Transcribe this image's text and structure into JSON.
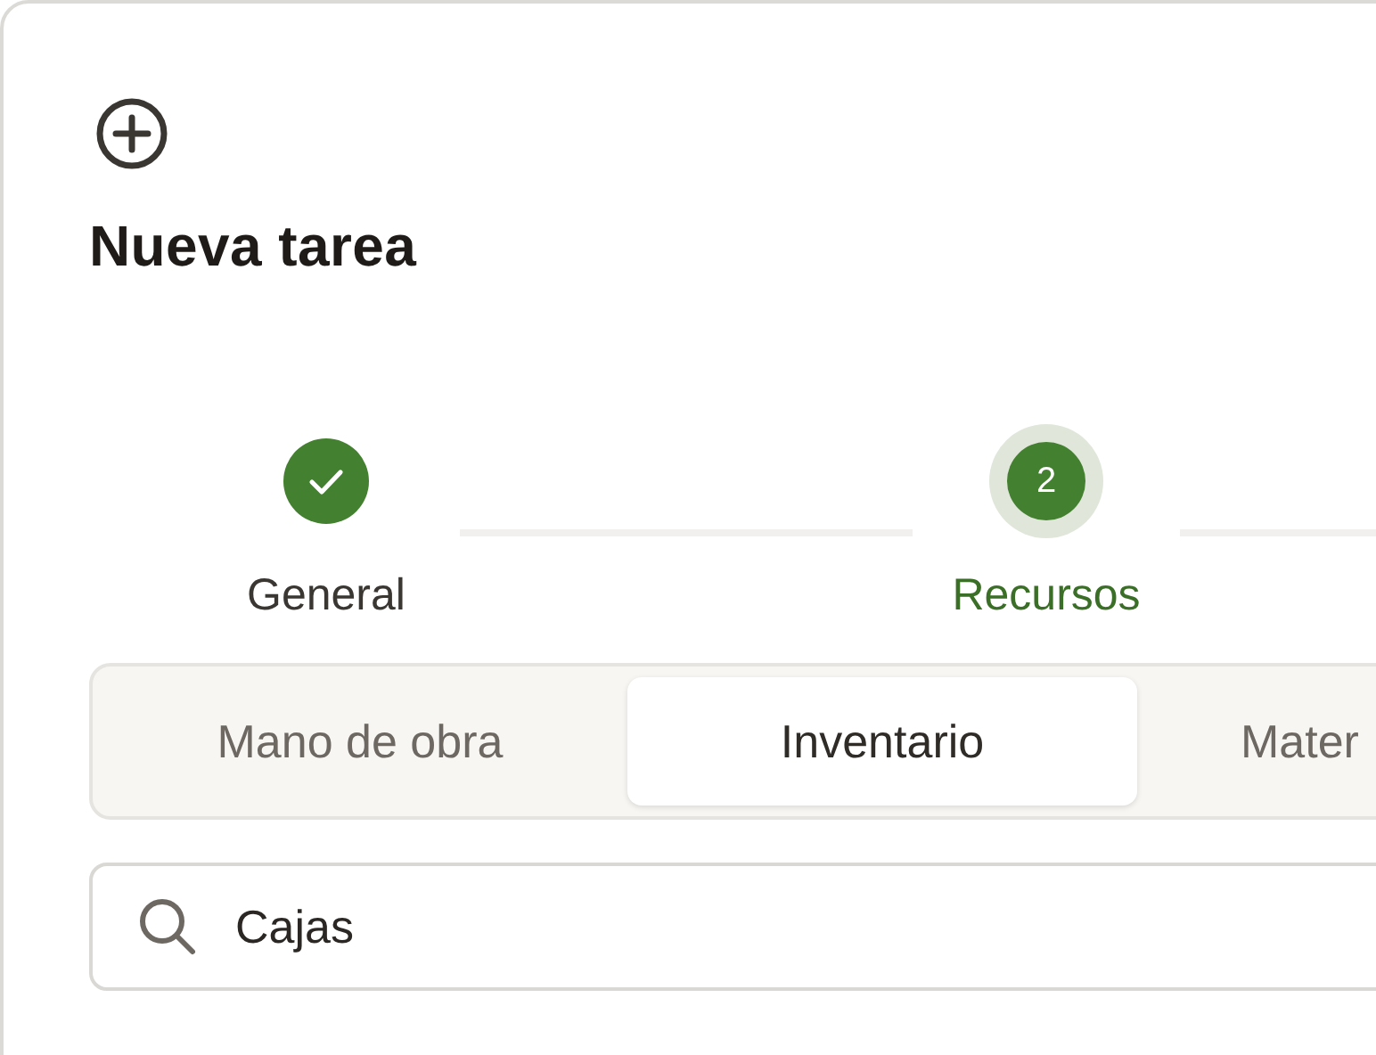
{
  "dialog": {
    "title": "Nueva tarea"
  },
  "steps": [
    {
      "label": "General",
      "completed": true,
      "current": false
    },
    {
      "label": "Recursos",
      "number": "2",
      "completed": false,
      "current": true
    }
  ],
  "tabs": [
    {
      "label": "Mano de obra",
      "selected": false
    },
    {
      "label": "Inventario",
      "selected": true
    },
    {
      "label": "Mater",
      "selected": false
    }
  ],
  "search": {
    "value": "Cajas"
  }
}
